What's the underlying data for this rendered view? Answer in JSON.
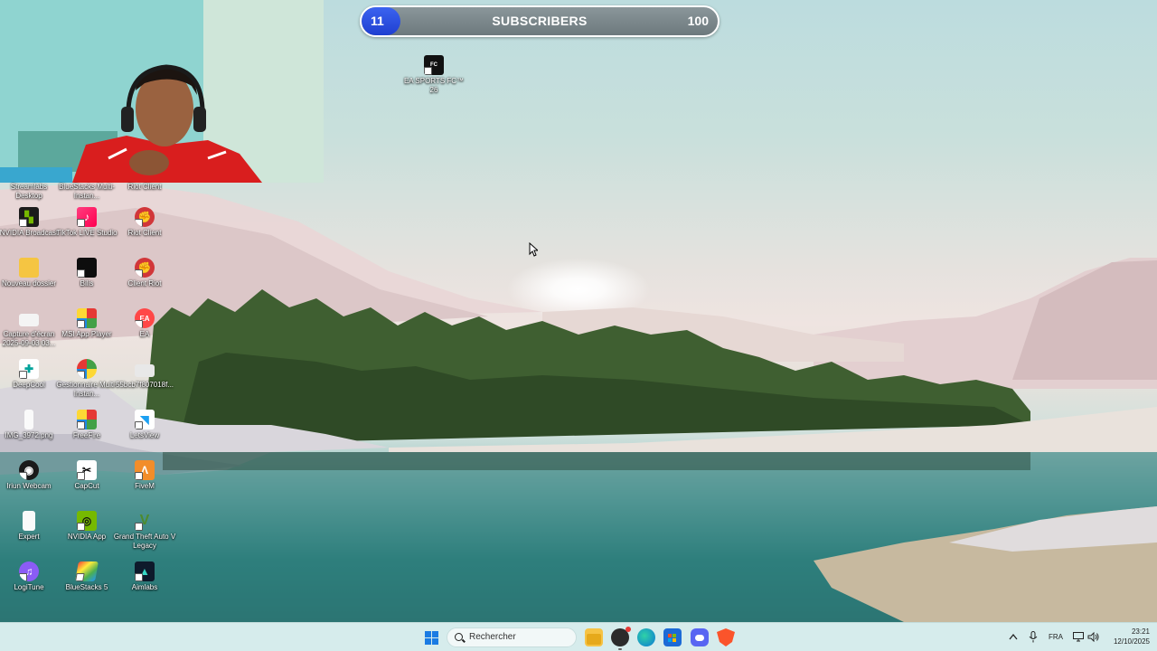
{
  "subscribers": {
    "current": "11",
    "title": "SUBSCRIBERS",
    "goal": "100",
    "progress": 0.11
  },
  "desktop_icons": {
    "ea_fc": "EA SPORTS FC™ 26",
    "r0": [
      "Streamlabs Desktop",
      "BlueStacks Multi-Instan...",
      "Riot Client"
    ],
    "r1": [
      "NVIDIA Broadcast",
      "TikTok LIVE Studio",
      "Riot Client"
    ],
    "r2": [
      "Nouveau dossier",
      "Bilis",
      "Client Riot"
    ],
    "r3": [
      "Capture d'écran 2025-09-03 03...",
      "MSI App Player",
      "EA"
    ],
    "r4": [
      "DeepCool",
      "Gestionnaire Multi-Instan...",
      "55bcb7f807018f..."
    ],
    "r5": [
      "IMG_3972.png",
      "FreeFire",
      "LetsView"
    ],
    "r6": [
      "Iriun Webcam",
      "CapCut",
      "FiveM"
    ],
    "r7": [
      "Expert",
      "NVIDIA App",
      "Grand Theft Auto V Legacy"
    ],
    "r8": [
      "LogiTune",
      "BlueStacks 5",
      "Aimlabs"
    ]
  },
  "taskbar": {
    "search_placeholder": "Rechercher",
    "apps": [
      "file-explorer",
      "obs",
      "edge",
      "store",
      "discord",
      "brave"
    ],
    "language": "FRA",
    "time": "23:21",
    "date": "12/10/2025"
  },
  "colors": {
    "subs_fill": "#2a4ee0",
    "taskbar": "#d6ecec",
    "start": "#1a7be3"
  }
}
